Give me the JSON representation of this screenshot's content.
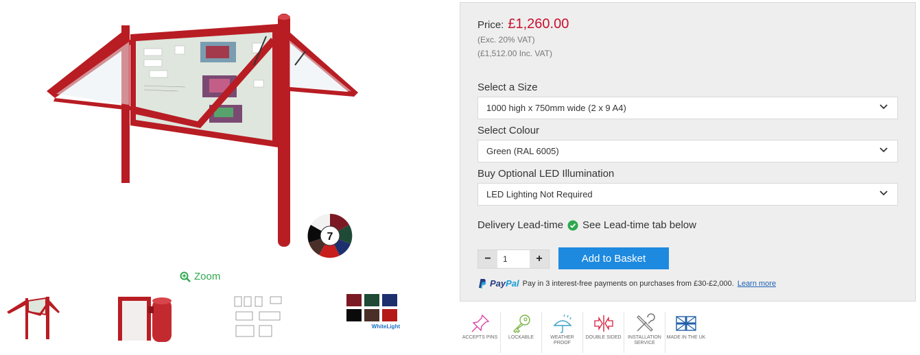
{
  "gallery": {
    "zoom_label": "Zoom",
    "colour_badge_number": "7",
    "thumbnail_brand": "WhiteLight",
    "swatch_colors": [
      "#7b1a24",
      "#1f4a36",
      "#1e2f6e",
      "#0a0a0a",
      "#4a2f28",
      "#b51a1a",
      "#f2f2f2"
    ]
  },
  "price": {
    "label": "Price:",
    "value": "£1,260.00",
    "exc_vat": "(Exc. 20% VAT)",
    "inc_vat": "(£1,512.00 Inc. VAT)"
  },
  "options": {
    "size": {
      "label": "Select a Size",
      "value": "1000 high x 750mm wide (2 x 9 A4)"
    },
    "colour": {
      "label": "Select Colour",
      "value": "Green (RAL 6005)"
    },
    "led": {
      "label": "Buy Optional LED Illumination",
      "value": "LED Lighting Not Required"
    }
  },
  "delivery": {
    "label": "Delivery Lead-time",
    "text": "See Lead-time tab below"
  },
  "quantity": {
    "value": "1",
    "minus": "−",
    "plus": "+"
  },
  "basket": {
    "label": "Add to Basket"
  },
  "paypal": {
    "logo_pay": "Pay",
    "logo_pal": "Pal",
    "text": "Pay in 3 interest-free payments on purchases from £30-£2,000.",
    "link": "Learn more"
  },
  "features": [
    {
      "label": "ACCEPTS PINS",
      "icon": "pin-icon",
      "color": "#d946a8"
    },
    {
      "label": "LOCKABLE",
      "icon": "key-icon",
      "color": "#7cb342"
    },
    {
      "label": "WEATHER PROOF",
      "icon": "weather-icon",
      "color": "#3aa0c8"
    },
    {
      "label": "DOUBLE SIDED",
      "icon": "double-sided-icon",
      "color": "#d81b3c"
    },
    {
      "label": "INSTALLATION SERVICE",
      "icon": "tools-icon",
      "color": "#777777"
    },
    {
      "label": "MADE IN THE UK",
      "icon": "uk-flag-icon",
      "color": "#1f5fa8"
    }
  ],
  "colors": {
    "price": "#c8102e",
    "button": "#1d8ae0",
    "success": "#2fa84f",
    "frame_red": "#b81d24"
  }
}
